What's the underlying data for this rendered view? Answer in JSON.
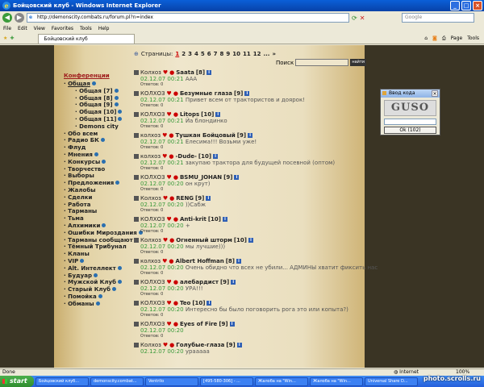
{
  "window": {
    "title": "Бойцовский клуб - Windows Internet Explorer"
  },
  "browser": {
    "url": "http://demonscity.combats.ru/forum.pl?n=index",
    "search_placeholder": "Google",
    "tab_title": "Бойцовский клуб",
    "menu": [
      "File",
      "Edit",
      "View",
      "Favorites",
      "Tools",
      "Help"
    ],
    "tools": [
      "Page",
      "Tools"
    ]
  },
  "forum": {
    "pages_label": "Страницы:",
    "current_page": "1",
    "pages": [
      "2",
      "3",
      "4",
      "5",
      "6",
      "7",
      "8",
      "9",
      "10",
      "11",
      "12",
      "..."
    ],
    "next": "»",
    "search_label": "Поиск",
    "search_button": "найти",
    "sidebar_header": "Конференции",
    "sidebar": [
      {
        "label": "Общая",
        "level": 0,
        "u": true,
        "dot": true
      },
      {
        "label": "Общая [7]",
        "level": 1,
        "dot": true
      },
      {
        "label": "Общая [8]",
        "level": 1,
        "dot": true
      },
      {
        "label": "Общая [9]",
        "level": 1,
        "dot": true
      },
      {
        "label": "Общая [10]",
        "level": 1,
        "dot": true
      },
      {
        "label": "Общая [11]",
        "level": 1,
        "dot": true
      },
      {
        "label": "Demons city",
        "level": 1,
        "dot": false
      },
      {
        "label": "Обо всем",
        "level": 0,
        "dot": false
      },
      {
        "label": "Радио БК",
        "level": 0,
        "dot": true
      },
      {
        "label": "Флуд",
        "level": 0,
        "dot": false
      },
      {
        "label": "Мнения",
        "level": 0,
        "dot": true
      },
      {
        "label": "Конкурсы",
        "level": 0,
        "dot": true
      },
      {
        "label": "Творчество",
        "level": 0,
        "dot": false
      },
      {
        "label": "Выборы",
        "level": 0,
        "dot": false
      },
      {
        "label": "Предложения",
        "level": 0,
        "dot": true
      },
      {
        "label": "Жалобы",
        "level": 0,
        "dot": false
      },
      {
        "label": "Сделки",
        "level": 0,
        "dot": false
      },
      {
        "label": "Работа",
        "level": 0,
        "dot": false
      },
      {
        "label": "Тарманы",
        "level": 0,
        "dot": false
      },
      {
        "label": "Тьма",
        "level": 0,
        "dot": false
      },
      {
        "label": "Алхимики",
        "level": 0,
        "dot": true
      },
      {
        "label": "Ошибки Мироздания",
        "level": 0,
        "dot": true
      },
      {
        "label": "Тарманы сообщают",
        "level": 0,
        "dot": false
      },
      {
        "label": "Тёмный Трибунал",
        "level": 0,
        "dot": false
      },
      {
        "label": "Кланы",
        "level": 0,
        "dot": false
      },
      {
        "label": "VIP",
        "level": 0,
        "dot": true
      },
      {
        "label": "Alt. Интеллект",
        "level": 0,
        "dot": true
      },
      {
        "label": "Будуар",
        "level": 0,
        "dot": true
      },
      {
        "label": "Мужской Клуб",
        "level": 0,
        "dot": true
      },
      {
        "label": "Старый Клуб",
        "level": 0,
        "dot": true
      },
      {
        "label": "Помойка",
        "level": 0,
        "dot": true
      },
      {
        "label": "Обманы",
        "level": 0,
        "dot": true
      }
    ],
    "posts": [
      {
        "clan": "Колхоз",
        "name": "Saata",
        "level": "[8]",
        "time": "02.12.07 00:21",
        "text": "ААА",
        "replies": "Ответов: 0"
      },
      {
        "clan": "КОЛХОЗ",
        "name": "Безумные глаза",
        "level": "[9]",
        "time": "02.12.07 00:21",
        "text": "Привет всем от трактористов и доярок!",
        "replies": "Ответов: 0"
      },
      {
        "clan": "КОЛХОЗ",
        "name": "Litops",
        "level": "[10]",
        "time": "02.12.07 00:21",
        "text": "Йа блондинко",
        "replies": "Ответов: 0"
      },
      {
        "clan": "колхоз",
        "name": "Тушкан Бойцовый",
        "level": "[9]",
        "time": "02.12.07 00:21",
        "text": "Елесима!!! Возьми уже!",
        "replies": "Ответов: 0"
      },
      {
        "clan": "колхоз",
        "name": "-Dude-",
        "level": "[10]",
        "time": "02.12.07 00:21",
        "text": "закупаю трактора для будущей посевной (оптом)",
        "replies": "Ответов: 0"
      },
      {
        "clan": "КОЛХОЗ",
        "name": "BSMU_JOHAN",
        "level": "[9]",
        "time": "02.12.07 00:20",
        "text": "он крут)",
        "replies": "Ответов: 0"
      },
      {
        "clan": "Колхоз",
        "name": "RENG",
        "level": "[9]",
        "time": "02.12.07 00:20",
        "text": "))Сабж",
        "replies": "Ответов: 0"
      },
      {
        "clan": "КОЛХОЗ",
        "name": "Anti-krit",
        "level": "[10]",
        "time": "02.12.07 00:20",
        "text": "+",
        "replies": "Ответов: 0"
      },
      {
        "clan": "Колхоз",
        "name": "Огненный шторм",
        "level": "[10]",
        "time": "02.12.07 00:20",
        "text": "мы лучшие)))",
        "replies": "Ответов: 0"
      },
      {
        "clan": "колхоз",
        "name": "Albert Hoffman",
        "level": "[8]",
        "time": "02.12.07 00:20",
        "text": "Очень обидно что всех не убили... АДМИНЫ хватит фиксить нас",
        "replies": "Ответов: 0"
      },
      {
        "clan": "КОЛХОЗ",
        "name": "алебардист",
        "level": "[9]",
        "time": "02.12.07 00:20",
        "text": "УРА!!!",
        "replies": "Ответов: 0"
      },
      {
        "clan": "КОЛХОЗ",
        "name": "Teo",
        "level": "[10]",
        "time": "02.12.07 00:20",
        "text": "Интересно бы было поговорить рога это или копыта?)",
        "replies": "Ответов: 0"
      },
      {
        "clan": "КОЛХОЗ",
        "name": "Eyes of Fire",
        "level": "[9]",
        "time": "02.12.07 00:20",
        "text": "",
        "replies": "Ответов: 0"
      },
      {
        "clan": "Колхоз",
        "name": "Голубые-глаза",
        "level": "[9]",
        "time": "02.12.07 00:20",
        "text": "урааааа",
        "replies": ""
      }
    ]
  },
  "popup": {
    "title": "Ввод кода",
    "captcha": "GUSO",
    "ok": "Ok (102)"
  },
  "status": {
    "left": "Done",
    "zone": "Internet",
    "zoom": "100%"
  },
  "taskbar": {
    "start": "start",
    "items": [
      "Бойцовский клуб...",
      "demonscity.combat...",
      "Ventrilo",
      "[495-580-306] - ...",
      "Жалоба на \"Win...",
      "Жалоба на \"Win...",
      "Universal Share D..."
    ]
  },
  "watermark": "photo.scrolls.ru"
}
